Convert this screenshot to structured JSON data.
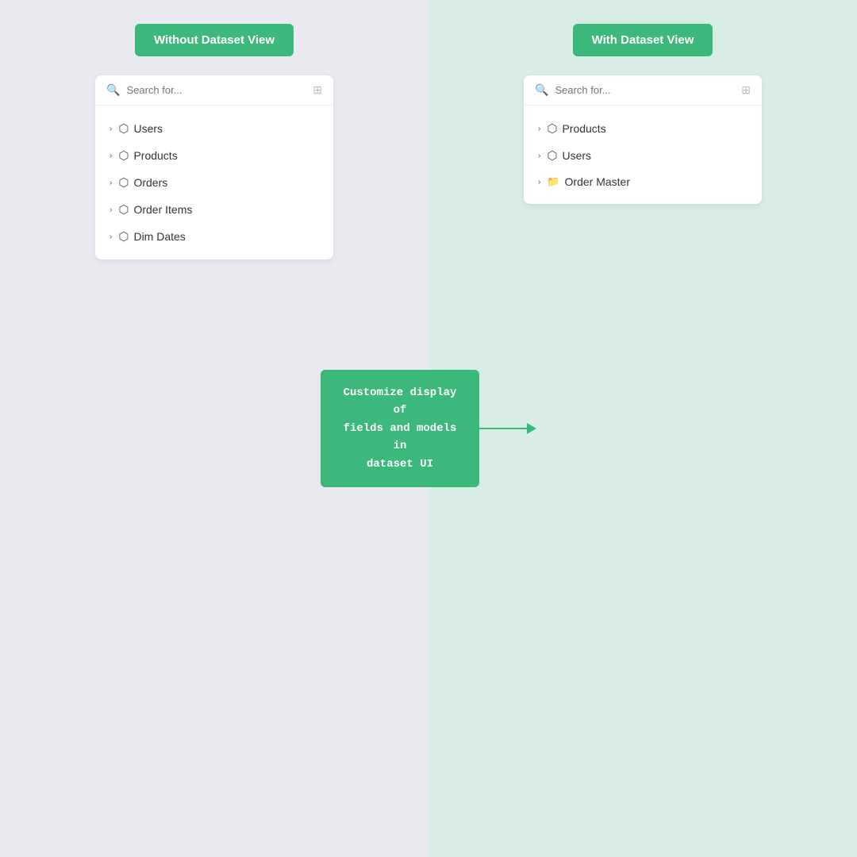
{
  "left_panel": {
    "button_label": "Without Dataset View",
    "search_placeholder": "Search for...",
    "items": [
      {
        "label": "Users",
        "icon": "cube"
      },
      {
        "label": "Products",
        "icon": "cube"
      },
      {
        "label": "Orders",
        "icon": "cube"
      },
      {
        "label": "Order Items",
        "icon": "cube"
      },
      {
        "label": "Dim Dates",
        "icon": "cube"
      }
    ]
  },
  "right_panel": {
    "button_label": "With Dataset View",
    "search_placeholder": "Search for...",
    "items": [
      {
        "label": "Products",
        "icon": "cube"
      },
      {
        "label": "Users",
        "icon": "cube"
      },
      {
        "label": "Order Master",
        "icon": "folder"
      }
    ]
  },
  "tooltip": {
    "line1": "Customize display of",
    "line2": "fields and models in",
    "line3": "dataset UI"
  },
  "colors": {
    "green": "#3cb87a",
    "left_bg": "#e8eaf0",
    "right_bg": "#d8ede5"
  }
}
